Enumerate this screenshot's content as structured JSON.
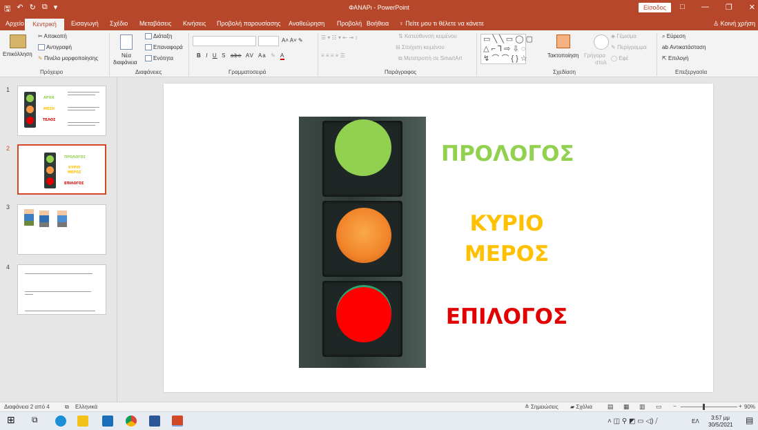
{
  "titlebar": {
    "title": "ΦΑΝΑΡι - PowerPoint",
    "signin": "Είσοδος",
    "qat": [
      "🖫",
      "↶",
      "↻",
      "⧉",
      "▾"
    ],
    "controls": [
      "□",
      "—",
      "❐",
      "✕"
    ]
  },
  "tabs": [
    "Αρχείο",
    "Κεντρική",
    "Εισαγωγή",
    "Σχέδιο",
    "Μεταβάσεις",
    "Κινήσεις",
    "Προβολή παρουσίασης",
    "Αναθεώρηση",
    "Προβολή",
    "Βοήθεια"
  ],
  "tell_me": "Πείτε μου τι θέλετε να κάνετε",
  "share": "Κοινή χρήση",
  "ribbon": {
    "clipboard": {
      "paste": "Επικόλληση",
      "cut": "Αποκοπή",
      "copy": "Αντιγραφή",
      "format_painter": "Πινέλο μορφοποίησης",
      "label": "Πρόχειρο"
    },
    "slides": {
      "new_slide": "Νέα",
      "new_slide2": "διαφάνεια",
      "layout": "Διάταξη",
      "reset": "Επαναφορά",
      "section": "Ενότητα",
      "label": "Διαφάνειες"
    },
    "font": {
      "label": "Γραμματοσειρά",
      "buttons": [
        "B",
        "I",
        "U",
        "S",
        "abc",
        "AV",
        "Aa",
        "A"
      ]
    },
    "paragraph": {
      "text_direction": "Κατεύθυνση κειμένου",
      "align_text": "Στοίχιση κειμένου",
      "smartart": "Μετατροπή σε SmartArt",
      "label": "Παράγραφος"
    },
    "drawing": {
      "arrange": "Τακτοποίηση",
      "quick_styles": "Γρήγορα",
      "quick_styles2": "στυλ",
      "fill": "Γέμισμα",
      "outline": "Περίγραμμα",
      "effects": "Εφέ",
      "label": "Σχεδίαση"
    },
    "editing": {
      "find": "Εύρεση",
      "replace": "Αντικατάσταση",
      "select": "Επιλογή",
      "label": "Επεξεργασία"
    }
  },
  "thumbnails": [
    {
      "number": "1",
      "labels": [
        "ΑΡΧΗ",
        "ΜΕΣΗ",
        "ΤΕΛΟΣ"
      ]
    },
    {
      "number": "2",
      "labels": [
        "ΠΡΟΛΟΓΟΣ",
        "ΚΥΡΙΟ",
        "ΜΕΡΟΣ",
        "ΕΠΙΛΟΓΟΣ"
      ]
    },
    {
      "number": "3"
    },
    {
      "number": "4"
    }
  ],
  "slide": {
    "prologue": "ΠΡΟΛΟΓΟΣ",
    "main1": "ΚΥΡΙΟ",
    "main2": "ΜΕΡΟΣ",
    "epilogue": "ΕΠΙΛΟΓΟΣ",
    "colors": {
      "green": "#92d050",
      "orange": "#ffc000",
      "red": "#e00000"
    }
  },
  "status": {
    "slide_info": "Διαφάνεια 2 από 4",
    "language": "Ελληνικά",
    "notes": "Σημειώσεις",
    "comments": "Σχόλια",
    "zoom": "90%"
  },
  "taskbar": {
    "lang": "ΕΛ",
    "time": "3:57 μμ",
    "date": "30/5/2021"
  }
}
